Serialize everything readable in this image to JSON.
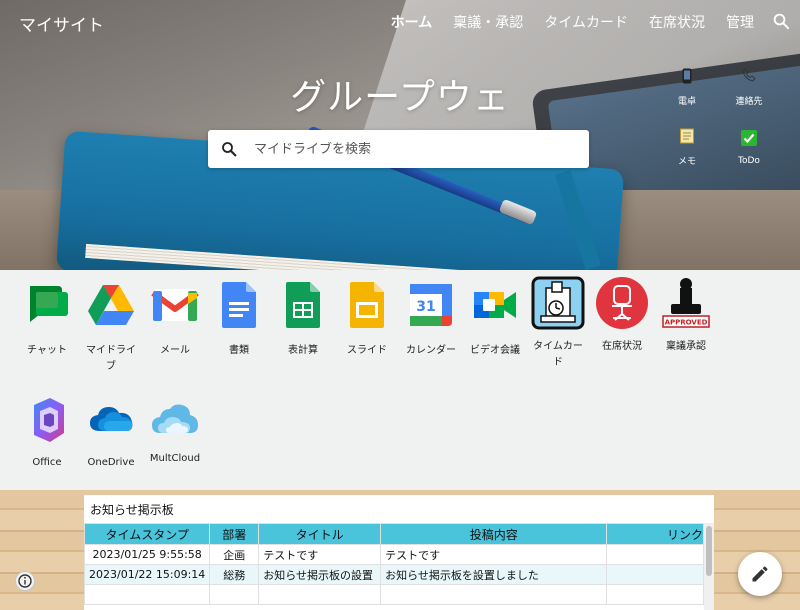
{
  "site": {
    "title": "マイサイト"
  },
  "nav": {
    "items": [
      "ホーム",
      "稟議・承認",
      "タイムカード",
      "在席状況",
      "管理"
    ]
  },
  "hero": {
    "title": "グループウェア",
    "search_placeholder": "マイドライブを検索"
  },
  "quick_links": [
    {
      "label": "電卓",
      "icon": "phone-icon"
    },
    {
      "label": "連絡先",
      "icon": "telephone-icon"
    },
    {
      "label": "メモ",
      "icon": "memo-icon"
    },
    {
      "label": "ToDo",
      "icon": "check-icon"
    }
  ],
  "apps": [
    {
      "label": "チャット",
      "icon": "google-chat-icon"
    },
    {
      "label": "マイドライブ",
      "icon": "google-drive-icon"
    },
    {
      "label": "メール",
      "icon": "gmail-icon"
    },
    {
      "label": "書類",
      "icon": "google-docs-icon"
    },
    {
      "label": "表計算",
      "icon": "google-sheets-icon"
    },
    {
      "label": "スライド",
      "icon": "google-slides-icon"
    },
    {
      "label": "カレンダー",
      "icon": "google-calendar-icon",
      "day": "31"
    },
    {
      "label": "ビデオ会議",
      "icon": "google-meet-icon"
    },
    {
      "label": "タイムカード",
      "icon": "timecard-icon"
    },
    {
      "label": "在席状況",
      "icon": "chair-icon"
    },
    {
      "label": "稟議承認",
      "icon": "approved-stamp-icon",
      "stamp_text": "APPROVED"
    },
    {
      "label": "Office",
      "icon": "office-icon"
    },
    {
      "label": "OneDrive",
      "icon": "onedrive-icon"
    },
    {
      "label": "MultCloud",
      "icon": "multcloud-icon"
    }
  ],
  "board": {
    "title": "お知らせ掲示板",
    "columns": [
      "タイムスタンプ",
      "部署",
      "タイトル",
      "投稿内容",
      "リンク"
    ],
    "rows": [
      [
        "2023/01/25 9:55:58",
        "企画",
        "テストです",
        "テストです",
        ""
      ],
      [
        "2023/01/22 15:09:14",
        "総務",
        "お知らせ掲示板の設置",
        "お知らせ掲示板を設置しました",
        ""
      ],
      [
        "",
        "",
        "",
        "",
        ""
      ]
    ]
  },
  "colors": {
    "header_cell": "#49c4db",
    "accent": "#4285f4"
  }
}
